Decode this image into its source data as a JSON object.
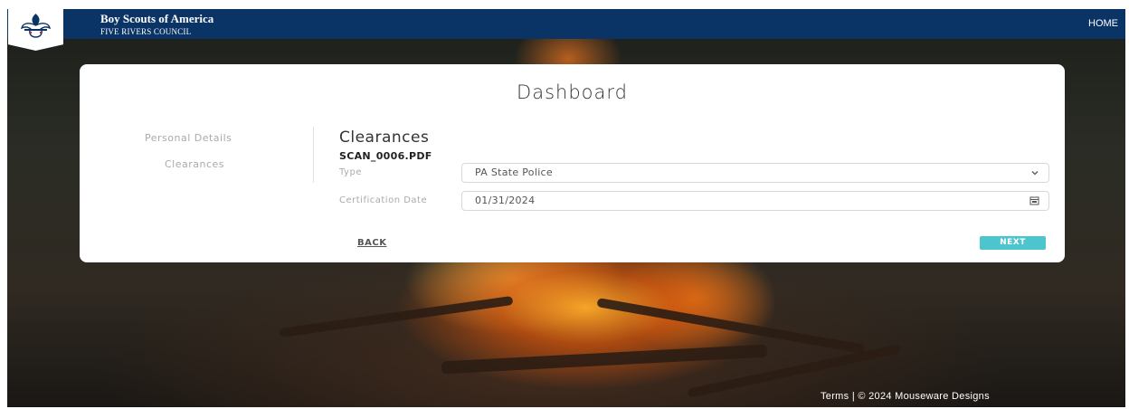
{
  "header": {
    "org_name": "Boy Scouts of America",
    "council_name": "FIVE RIVERS COUNCIL",
    "home_label": "HOME",
    "logo_icon": "fleur-de-lis-icon",
    "bar_color": "#0b3466"
  },
  "dashboard": {
    "title": "Dashboard"
  },
  "sidebar": {
    "items": [
      {
        "label": "Personal Details"
      },
      {
        "label": "Clearances"
      }
    ]
  },
  "clearances": {
    "title": "Clearances",
    "file_name": "SCAN_0006.PDF",
    "type_label": "Type",
    "type_value": "PA State Police",
    "type_icon": "chevron-down-icon",
    "date_label": "Certification Date",
    "date_value": "01/31/2024",
    "date_icon": "calendar-icon"
  },
  "actions": {
    "back_label": "BACK",
    "next_label": "NEXT",
    "next_color": "#4dc5cf"
  },
  "footer": {
    "terms_label": "Terms",
    "separator": "|",
    "copyright": "© 2024 Mouseware Designs"
  }
}
